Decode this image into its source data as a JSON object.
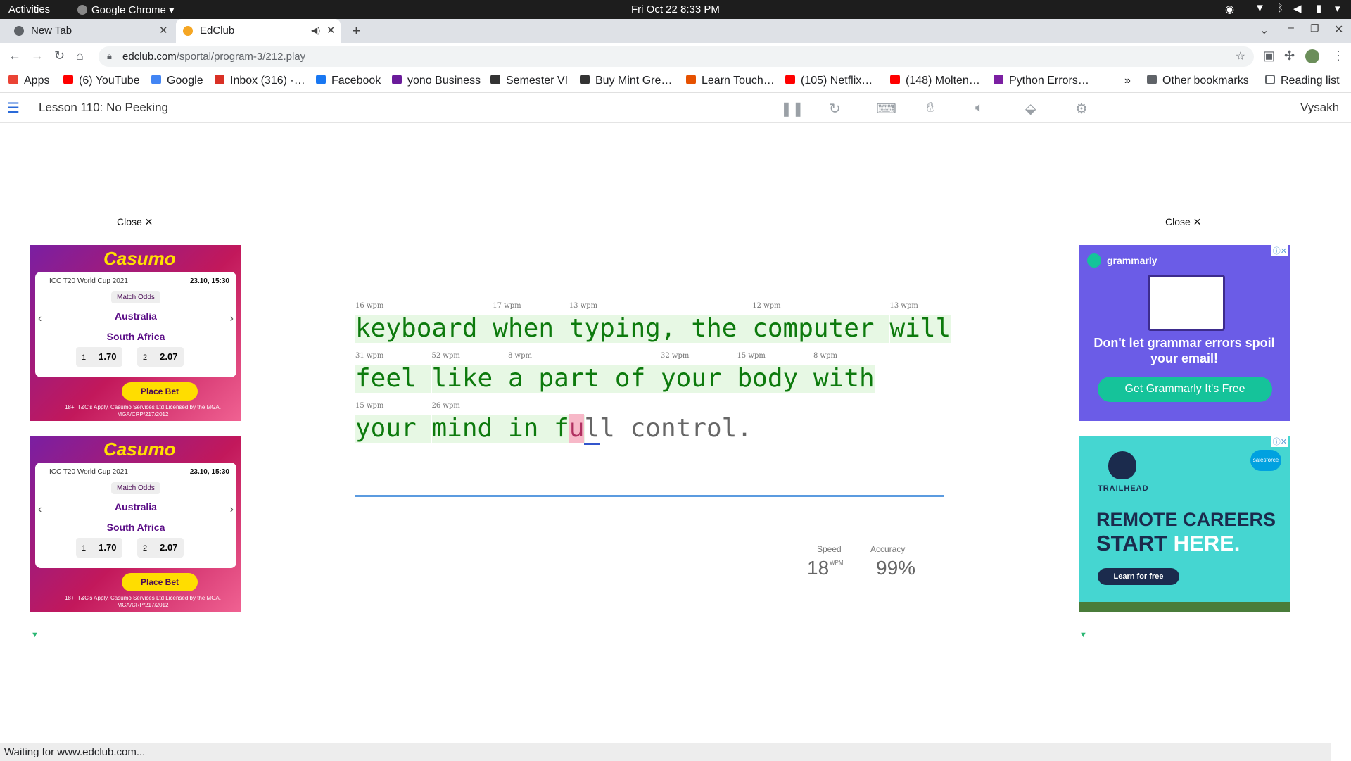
{
  "system_bar": {
    "activities": "Activities",
    "app": "Google Chrome ▾",
    "clock": "Fri Oct 22  8:33 PM"
  },
  "tabs": [
    {
      "title": "New Tab"
    },
    {
      "title": "EdClub"
    }
  ],
  "address": {
    "host": "edclub.com",
    "path": "/sportal/program-3/212.play"
  },
  "bookmarks": [
    {
      "label": "Apps",
      "color": "#ea4335"
    },
    {
      "label": "(6) YouTube",
      "color": "#ff0000"
    },
    {
      "label": "Google",
      "color": "#4285f4"
    },
    {
      "label": "Inbox (316) -…",
      "color": "#d93025"
    },
    {
      "label": "Facebook",
      "color": "#1877f2"
    },
    {
      "label": "yono Business",
      "color": "#6a1b9a"
    },
    {
      "label": "Semester VI",
      "color": "#333333"
    },
    {
      "label": "Buy Mint Gre…",
      "color": "#333333"
    },
    {
      "label": "Learn Touch…",
      "color": "#e65100"
    },
    {
      "label": "(105) Netflix…",
      "color": "#ff0000"
    },
    {
      "label": "(148) Molten…",
      "color": "#ff0000"
    },
    {
      "label": "Python Errors…",
      "color": "#7b1fa2"
    }
  ],
  "bookmarks_overflow": "»",
  "other_bookmarks": "Other bookmarks",
  "reading_list": "Reading list",
  "lesson": {
    "title": "Lesson 110: No Peeking",
    "user": "Vysakh"
  },
  "ads": {
    "close_label": "Close ✕",
    "casumo": {
      "brand": "Casumo",
      "event": "ICC T20 World Cup 2021",
      "datetime": "23.10, 15:30",
      "market": "Match Odds",
      "team1": "Australia",
      "team2": "South Africa",
      "odd1_label": "1",
      "odd1": "1.70",
      "odd2_label": "2",
      "odd2": "2.07",
      "cta": "Place Bet",
      "fine": "18+. T&C's Apply. Casumo Services Ltd Licensed by the MGA. MGA/CRP/217/2012"
    },
    "grammarly": {
      "brand": "grammarly",
      "headline": "Don't let grammar errors spoil your email!",
      "cta": "Get Grammarly  It's Free"
    },
    "trailhead": {
      "brand": "TRAILHEAD",
      "partner": "salesforce",
      "headline1": "REMOTE CAREERS",
      "headline2a": "START ",
      "headline2b": "HERE.",
      "cta": "Learn for free"
    }
  },
  "typing": {
    "wpm_unit": "wpm",
    "lines": [
      {
        "words": [
          {
            "text": "keyboard",
            "wpm": "16"
          },
          {
            "text": "when",
            "wpm": "17"
          },
          {
            "text": "typing,",
            "wpm": "13"
          },
          {
            "text": "the",
            "wpm": ""
          },
          {
            "text": "computer",
            "wpm": "12"
          },
          {
            "text": "will",
            "wpm": "13"
          }
        ]
      },
      {
        "words": [
          {
            "text": "feel",
            "wpm": "31"
          },
          {
            "text": "like",
            "wpm": "52"
          },
          {
            "text": "a",
            "wpm": "8"
          },
          {
            "text": "part",
            "wpm": ""
          },
          {
            "text": "of",
            "wpm": ""
          },
          {
            "text": "your",
            "wpm": "32"
          },
          {
            "text": "body",
            "wpm": "15"
          },
          {
            "text": "with",
            "wpm": "8"
          }
        ]
      },
      {
        "words": [
          {
            "text": "your",
            "wpm": "15"
          },
          {
            "text": "mind",
            "wpm": "26"
          },
          {
            "text": "in",
            "wpm": ""
          },
          {
            "text": "full",
            "wpm": ""
          },
          {
            "text": "control.",
            "wpm": ""
          }
        ]
      }
    ],
    "progress": 0.92
  },
  "stats": {
    "speed_label": "Speed",
    "speed": "18",
    "speed_unit": "WPM",
    "accuracy_label": "Accuracy",
    "accuracy": "99%"
  },
  "status_bar": "Waiting for www.edclub.com..."
}
